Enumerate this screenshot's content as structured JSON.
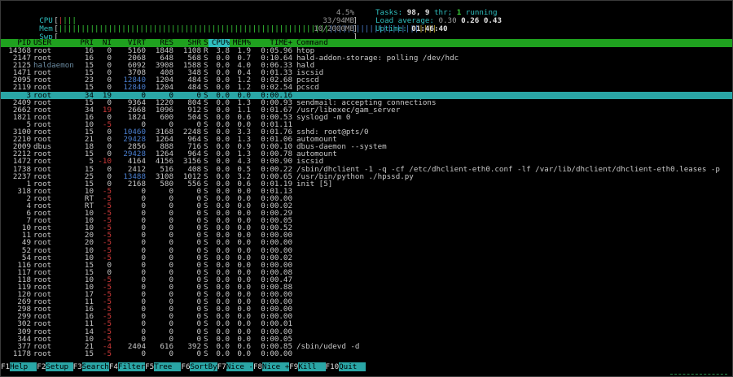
{
  "meters": {
    "cpu": {
      "label": "CPU",
      "value": "4.5%"
    },
    "mem": {
      "label": "Mem",
      "value": "33/94MB"
    },
    "swp": {
      "label": "Swp",
      "value": "10/2000MB"
    }
  },
  "info": {
    "tasks_label": "Tasks:",
    "tasks": "98,",
    "thr": "9",
    "thr_label": "thr;",
    "running": "1",
    "running_label": "running",
    "load_label": "Load average:",
    "load1": "0.30",
    "load5": "0.26",
    "load15": "0.43",
    "uptime_label": "Uptime:",
    "uptime": "01:46:40"
  },
  "columns": [
    "PID",
    "USER",
    "PRI",
    "NI",
    "VIRT",
    "RES",
    "SHR",
    "S",
    "CPU%",
    "MEM%",
    "TIME+",
    "Command"
  ],
  "sort_column": "CPU%",
  "selected_index": 6,
  "processes": [
    [
      "14368",
      "root",
      "16",
      "0",
      "5160",
      "1848",
      "1108",
      "R",
      "3.8",
      "1.9",
      "0:05.96",
      "htop"
    ],
    [
      "2147",
      "root",
      "16",
      "0",
      "2068",
      "648",
      "568",
      "S",
      "0.0",
      "0.7",
      "0:10.64",
      "hald-addon-storage: polling /dev/hdc"
    ],
    [
      "2125",
      "haldaemon",
      "15",
      "0",
      "6092",
      "3908",
      "1588",
      "S",
      "0.0",
      "4.0",
      "0:06.33",
      "hald"
    ],
    [
      "1471",
      "root",
      "15",
      "0",
      "3708",
      "408",
      "348",
      "S",
      "0.0",
      "0.4",
      "0:01.33",
      "iscsid"
    ],
    [
      "2095",
      "root",
      "23",
      "0",
      "12840",
      "1204",
      "484",
      "S",
      "0.0",
      "1.2",
      "0:02.68",
      "pcscd"
    ],
    [
      "2119",
      "root",
      "15",
      "0",
      "12840",
      "1204",
      "484",
      "S",
      "0.0",
      "1.2",
      "0:02.54",
      "pcscd"
    ],
    [
      "3",
      "root",
      "34",
      "19",
      "0",
      "0",
      "0",
      "S",
      "0.0",
      "0.0",
      "0:00.16",
      ""
    ],
    [
      "2409",
      "root",
      "15",
      "0",
      "9364",
      "1220",
      "804",
      "S",
      "0.0",
      "1.3",
      "0:00.93",
      "sendmail: accepting connections"
    ],
    [
      "2662",
      "root",
      "34",
      "19",
      "2668",
      "1096",
      "912",
      "S",
      "0.0",
      "1.1",
      "0:01.67",
      "/usr/libexec/gam_server"
    ],
    [
      "1821",
      "root",
      "16",
      "0",
      "1824",
      "600",
      "504",
      "S",
      "0.0",
      "0.6",
      "0:00.53",
      "syslogd -m 0"
    ],
    [
      "5",
      "root",
      "10",
      "-5",
      "0",
      "0",
      "0",
      "S",
      "0.0",
      "0.0",
      "0:01.11",
      ""
    ],
    [
      "3100",
      "root",
      "15",
      "0",
      "10460",
      "3168",
      "2248",
      "S",
      "0.0",
      "3.3",
      "0:01.76",
      "sshd: root@pts/0"
    ],
    [
      "2210",
      "root",
      "21",
      "0",
      "29428",
      "1264",
      "964",
      "S",
      "0.0",
      "1.3",
      "0:01.06",
      "automount"
    ],
    [
      "2009",
      "dbus",
      "18",
      "0",
      "2856",
      "888",
      "716",
      "S",
      "0.0",
      "0.9",
      "0:00.10",
      "dbus-daemon --system"
    ],
    [
      "2212",
      "root",
      "15",
      "0",
      "29428",
      "1264",
      "964",
      "S",
      "0.0",
      "1.3",
      "0:00.78",
      "automount"
    ],
    [
      "1472",
      "root",
      "5",
      "-10",
      "4164",
      "4156",
      "3156",
      "S",
      "0.0",
      "4.3",
      "0:00.90",
      "iscsid"
    ],
    [
      "1738",
      "root",
      "15",
      "0",
      "2412",
      "516",
      "408",
      "S",
      "0.0",
      "0.5",
      "0:00.22",
      "/sbin/dhclient -1 -q -cf /etc/dhclient-eth0.conf -lf /var/lib/dhclient/dhclient-eth0.leases -p"
    ],
    [
      "2237",
      "root",
      "25",
      "0",
      "13488",
      "3108",
      "1012",
      "S",
      "0.0",
      "3.2",
      "0:00.65",
      "/usr/bin/python ./hpssd.py"
    ],
    [
      "1",
      "root",
      "15",
      "0",
      "2168",
      "580",
      "556",
      "S",
      "0.0",
      "0.6",
      "0:01.19",
      "init [5]"
    ],
    [
      "318",
      "root",
      "10",
      "-5",
      "0",
      "0",
      "0",
      "S",
      "0.0",
      "0.0",
      "0:01.13",
      ""
    ],
    [
      "2",
      "root",
      "RT",
      "-5",
      "0",
      "0",
      "0",
      "S",
      "0.0",
      "0.0",
      "0:00.00",
      ""
    ],
    [
      "4",
      "root",
      "RT",
      "-5",
      "0",
      "0",
      "0",
      "S",
      "0.0",
      "0.0",
      "0:00.02",
      ""
    ],
    [
      "6",
      "root",
      "10",
      "-5",
      "0",
      "0",
      "0",
      "S",
      "0.0",
      "0.0",
      "0:00.29",
      ""
    ],
    [
      "7",
      "root",
      "10",
      "-5",
      "0",
      "0",
      "0",
      "S",
      "0.0",
      "0.0",
      "0:00.05",
      ""
    ],
    [
      "10",
      "root",
      "10",
      "-5",
      "0",
      "0",
      "0",
      "S",
      "0.0",
      "0.0",
      "0:00.52",
      ""
    ],
    [
      "11",
      "root",
      "20",
      "-5",
      "0",
      "0",
      "0",
      "S",
      "0.0",
      "0.0",
      "0:00.00",
      ""
    ],
    [
      "49",
      "root",
      "20",
      "-5",
      "0",
      "0",
      "0",
      "S",
      "0.0",
      "0.0",
      "0:00.00",
      ""
    ],
    [
      "52",
      "root",
      "10",
      "-5",
      "0",
      "0",
      "0",
      "S",
      "0.0",
      "0.0",
      "0:00.00",
      ""
    ],
    [
      "54",
      "root",
      "10",
      "-5",
      "0",
      "0",
      "0",
      "S",
      "0.0",
      "0.0",
      "0:00.02",
      ""
    ],
    [
      "116",
      "root",
      "15",
      "0",
      "0",
      "0",
      "0",
      "S",
      "0.0",
      "0.0",
      "0:00.00",
      ""
    ],
    [
      "117",
      "root",
      "15",
      "0",
      "0",
      "0",
      "0",
      "S",
      "0.0",
      "0.0",
      "0:00.08",
      ""
    ],
    [
      "118",
      "root",
      "10",
      "-5",
      "0",
      "0",
      "0",
      "S",
      "0.0",
      "0.0",
      "0:00.47",
      ""
    ],
    [
      "119",
      "root",
      "10",
      "-5",
      "0",
      "0",
      "0",
      "S",
      "0.0",
      "0.0",
      "0:00.88",
      ""
    ],
    [
      "120",
      "root",
      "17",
      "-5",
      "0",
      "0",
      "0",
      "S",
      "0.0",
      "0.0",
      "0:00.00",
      ""
    ],
    [
      "269",
      "root",
      "11",
      "-5",
      "0",
      "0",
      "0",
      "S",
      "0.0",
      "0.0",
      "0:00.00",
      ""
    ],
    [
      "298",
      "root",
      "16",
      "-5",
      "0",
      "0",
      "0",
      "S",
      "0.0",
      "0.0",
      "0:00.00",
      ""
    ],
    [
      "299",
      "root",
      "16",
      "-5",
      "0",
      "0",
      "0",
      "S",
      "0.0",
      "0.0",
      "0:00.00",
      ""
    ],
    [
      "302",
      "root",
      "11",
      "-5",
      "0",
      "0",
      "0",
      "S",
      "0.0",
      "0.0",
      "0:00.01",
      ""
    ],
    [
      "309",
      "root",
      "14",
      "-5",
      "0",
      "0",
      "0",
      "S",
      "0.0",
      "0.0",
      "0:00.00",
      ""
    ],
    [
      "344",
      "root",
      "10",
      "-5",
      "0",
      "0",
      "0",
      "S",
      "0.0",
      "0.0",
      "0:00.05",
      ""
    ],
    [
      "377",
      "root",
      "21",
      "-4",
      "2404",
      "616",
      "392",
      "S",
      "0.0",
      "0.6",
      "0:00.85",
      "/sbin/udevd -d"
    ],
    [
      "1178",
      "root",
      "15",
      "-5",
      "0",
      "0",
      "0",
      "S",
      "0.0",
      "0.0",
      "0:00.00",
      ""
    ]
  ],
  "footer": [
    {
      "key": "F1",
      "label": "Help"
    },
    {
      "key": "F2",
      "label": "Setup"
    },
    {
      "key": "F3",
      "label": "Search"
    },
    {
      "key": "F4",
      "label": "Filter"
    },
    {
      "key": "F5",
      "label": "Tree"
    },
    {
      "key": "F6",
      "label": "SortBy"
    },
    {
      "key": "F7",
      "label": "Nice -"
    },
    {
      "key": "F8",
      "label": "Nice +"
    },
    {
      "key": "F9",
      "label": "Kill"
    },
    {
      "key": "F10",
      "label": "Quit"
    }
  ],
  "colors": {
    "header_bg": "#1fa11f",
    "selected_bg": "#2aa6a6",
    "cyan": "#2fbfbf",
    "red": "#d03b3b"
  }
}
